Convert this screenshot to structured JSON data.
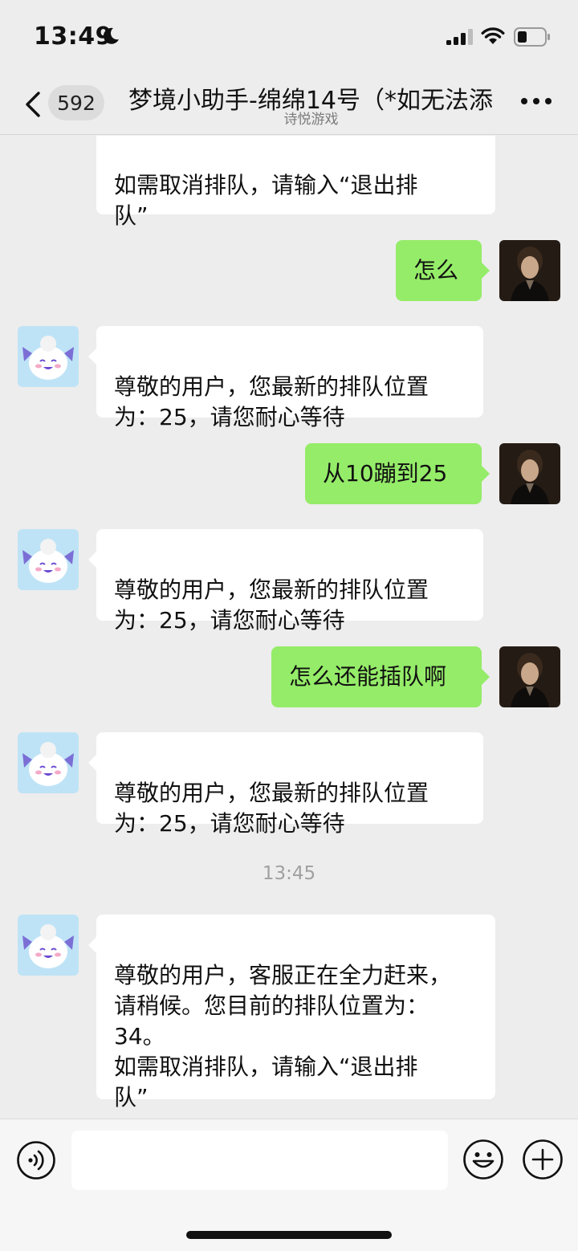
{
  "status_bar": {
    "time": "13:49",
    "icons": [
      "moon-icon",
      "signal-icon",
      "wifi-icon",
      "battery-icon"
    ]
  },
  "header": {
    "unread_count": "592",
    "title": "梦境小助手-绵绵14号（*如无法添",
    "subtitle": "诗悦游戏",
    "icons": [
      "back-chevron-icon",
      "more-dots-icon"
    ]
  },
  "messages": [
    {
      "id": "m0",
      "side": "in",
      "text": "如需取消排队，请输入“退出排\n队”"
    },
    {
      "id": "m1",
      "side": "out",
      "text": "怎么"
    },
    {
      "id": "m2",
      "side": "in",
      "text": "尊敬的用户，您最新的排队位置\n为：25，请您耐心等待"
    },
    {
      "id": "m3",
      "side": "out",
      "text": "从10蹦到25"
    },
    {
      "id": "m4",
      "side": "in",
      "text": "尊敬的用户，您最新的排队位置\n为：25，请您耐心等待"
    },
    {
      "id": "m5",
      "side": "out",
      "text": "怎么还能插队啊"
    },
    {
      "id": "m6",
      "side": "in",
      "text": "尊敬的用户，您最新的排队位置\n为：25，请您耐心等待"
    },
    {
      "id": "m7",
      "side": "in",
      "text": "尊敬的用户，客服正在全力赶来，\n请稍候。您目前的排队位置为：\n34。\n如需取消排队，请输入“退出排\n队”"
    }
  ],
  "timestamp": "13:45",
  "input_bar": {
    "placeholder": "",
    "icons": [
      "voice-icon",
      "emoji-icon",
      "plus-icon"
    ]
  },
  "colors": {
    "background": "#ededed",
    "outgoing_bubble": "#95ec69",
    "incoming_bubble": "#ffffff",
    "accent": "#07c160"
  }
}
